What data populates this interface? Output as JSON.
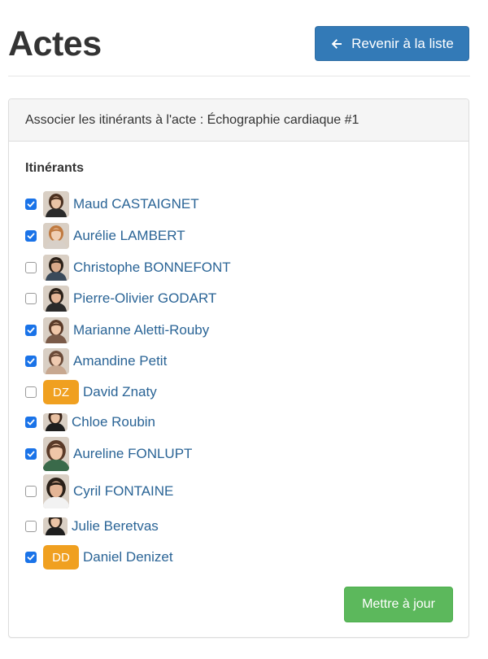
{
  "page": {
    "title": "Actes",
    "back_label": "Revenir à la liste"
  },
  "panel": {
    "heading": "Associer les itinérants à l'acte : Échographie cardiaque #1",
    "section_label": "Itinérants",
    "submit_label": "Mettre à jour"
  },
  "itinerants": [
    {
      "name": "Maud CASTAIGNET",
      "checked": true,
      "avatar": {
        "type": "photo",
        "hair": "#4a3020",
        "shirt": "#2a2a2a",
        "skin": "#e9c3a5"
      }
    },
    {
      "name": "Aurélie LAMBERT",
      "checked": true,
      "avatar": {
        "type": "photo",
        "hair": "#c07a40",
        "shirt": "#d8d0c8",
        "skin": "#f0cfb3"
      }
    },
    {
      "name": "Christophe BONNEFONT",
      "checked": false,
      "avatar": {
        "type": "photo",
        "hair": "#2a2018",
        "shirt": "#3a4a5a",
        "skin": "#d9a98a"
      }
    },
    {
      "name": "Pierre-Olivier GODART",
      "checked": false,
      "avatar": {
        "type": "photo",
        "hair": "#2a2018",
        "shirt": "#2a2a2a",
        "skin": "#e4b596"
      }
    },
    {
      "name": "Marianne Aletti-Rouby",
      "checked": true,
      "avatar": {
        "type": "photo",
        "hair": "#5a3a28",
        "shirt": "#7a5a48",
        "skin": "#efc6a8"
      }
    },
    {
      "name": "Amandine Petit",
      "checked": true,
      "avatar": {
        "type": "photo",
        "hair": "#6a4a38",
        "shirt": "#c8a890",
        "skin": "#efcab0"
      }
    },
    {
      "name": "David Znaty",
      "checked": false,
      "avatar": {
        "type": "initials",
        "text": "DZ",
        "color": "#f0a020"
      }
    },
    {
      "name": "Chloe Roubin",
      "checked": true,
      "avatar": {
        "type": "photo",
        "hair": "#3a2418",
        "shirt": "#1e1e1e",
        "skin": "#e8c0a2"
      }
    },
    {
      "name": "Aureline FONLUPT",
      "checked": true,
      "avatar": {
        "type": "photo",
        "hair": "#5a3a28",
        "shirt": "#3a6a4a",
        "skin": "#efc6a8"
      }
    },
    {
      "name": "Cyril FONTAINE",
      "checked": false,
      "avatar": {
        "type": "photo",
        "hair": "#2a2018",
        "shirt": "#f2f2f2",
        "skin": "#e4b596"
      }
    },
    {
      "name": "Julie Beretvas",
      "checked": false,
      "avatar": {
        "type": "photo",
        "hair": "#2a2018",
        "shirt": "#1e1e1e",
        "skin": "#ecc4a6"
      }
    },
    {
      "name": "Daniel Denizet",
      "checked": true,
      "avatar": {
        "type": "initials",
        "text": "DD",
        "color": "#f0a020"
      }
    }
  ],
  "colors": {
    "primary": "#337ab7",
    "success": "#5cb85c",
    "link": "#2a6496",
    "checkbox_checked": "#1a73e8",
    "initials_avatar": "#f0a020"
  },
  "icons": {
    "back": "arrow-left-icon",
    "check": "check-icon"
  }
}
